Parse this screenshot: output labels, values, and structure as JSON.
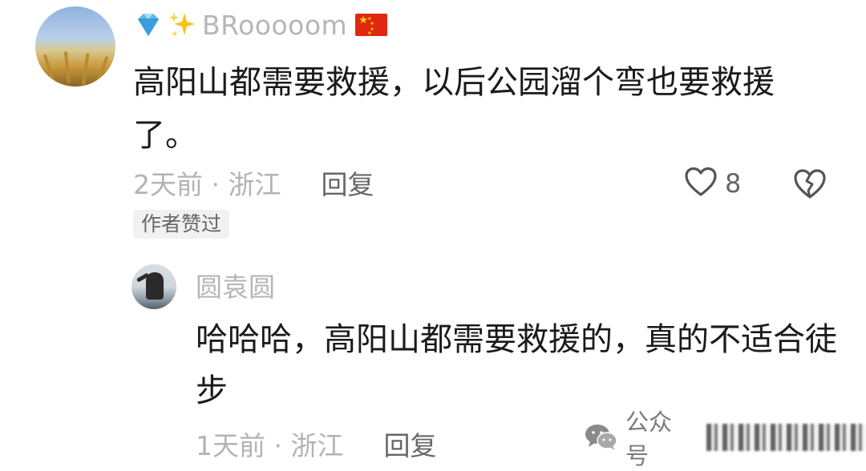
{
  "comment": {
    "username": "BRooooom",
    "text": "高阳山都需要救援，以后公园溜个弯也要救援了。",
    "time_location": "2天前 · 浙江",
    "reply_label": "回复",
    "like_count": "8",
    "badge": "作者赞过"
  },
  "reply": {
    "username": "圆袁圆",
    "text": "哈哈哈，高阳山都需要救援的，真的不适合徒步",
    "time_location": "1天前 · 浙江",
    "reply_label": "回复"
  },
  "watermark": {
    "label": "公众号"
  },
  "icons": {
    "gem": "gem-icon",
    "sparkle": "sparkle-icon",
    "flag": "china-flag-icon",
    "like": "heart-icon",
    "dislike": "broken-heart-icon",
    "watermark": "wechat-icon"
  },
  "colors": {
    "text": "#1a1a1a",
    "muted": "#b3b3b3",
    "action": "#666666",
    "badge_bg": "#f1f1f1",
    "flag_red": "#de2910"
  }
}
